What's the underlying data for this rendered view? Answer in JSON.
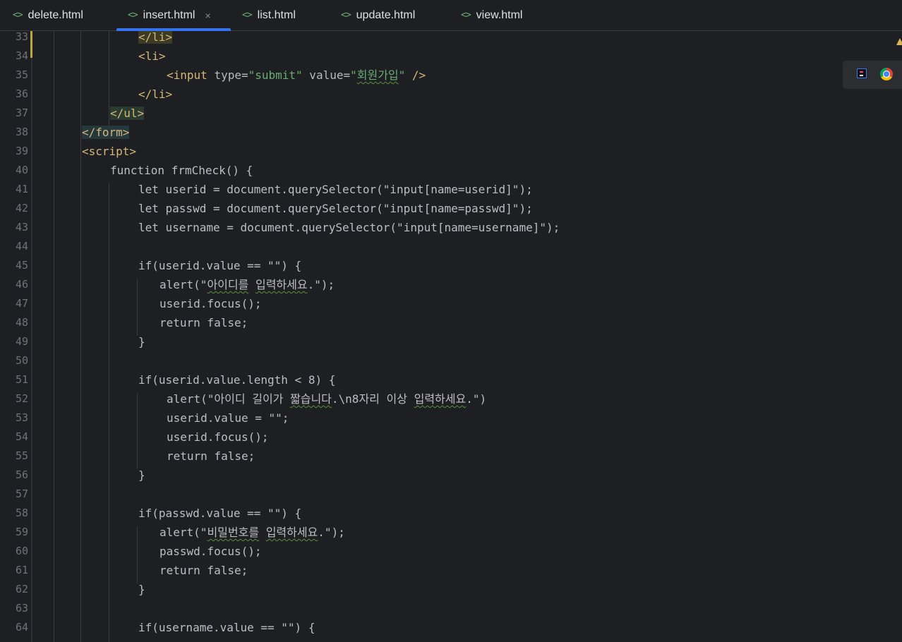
{
  "tabs": [
    {
      "label": "delete.html",
      "icon": "<>"
    },
    {
      "label": "insert.html",
      "icon": "<>",
      "active": true
    },
    {
      "label": "list.html",
      "icon": "<>"
    },
    {
      "label": "update.html",
      "icon": "<>"
    },
    {
      "label": "view.html",
      "icon": "<>"
    }
  ],
  "close_glyph": "×",
  "lines": [
    {
      "n": "33"
    },
    {
      "n": "34"
    },
    {
      "n": "35"
    },
    {
      "n": "36"
    },
    {
      "n": "37"
    },
    {
      "n": "38"
    },
    {
      "n": "39"
    },
    {
      "n": "40"
    },
    {
      "n": "41"
    },
    {
      "n": "42"
    },
    {
      "n": "43"
    },
    {
      "n": "44"
    },
    {
      "n": "45"
    },
    {
      "n": "46"
    },
    {
      "n": "47"
    },
    {
      "n": "48"
    },
    {
      "n": "49"
    },
    {
      "n": "50"
    },
    {
      "n": "51"
    },
    {
      "n": "52"
    },
    {
      "n": "53"
    },
    {
      "n": "54"
    },
    {
      "n": "55"
    },
    {
      "n": "56"
    },
    {
      "n": "57"
    },
    {
      "n": "58"
    },
    {
      "n": "59"
    },
    {
      "n": "60"
    },
    {
      "n": "61"
    },
    {
      "n": "62"
    },
    {
      "n": "63"
    },
    {
      "n": "64"
    }
  ],
  "code": {
    "l33": "</li>",
    "l34": "<li>",
    "l35_open": "<input ",
    "l35_attr1": "type=",
    "l35_val1": "\"submit\"",
    "l35_attr2": " value=",
    "l35_q1": "\"",
    "l35_val2": "회원가입",
    "l35_q2": "\"",
    "l35_close": " />",
    "l36": "</li>",
    "l37": "</ul>",
    "l38": "</form>",
    "l39": "<script>",
    "l40": "function frmCheck() {",
    "l41": "let userid = document.querySelector(\"input[name=userid]\");",
    "l42": "let passwd = document.querySelector(\"input[name=passwd]\");",
    "l43": "let username = document.querySelector(\"input[name=username]\");",
    "l45": "if(userid.value == \"\") {",
    "l46_a": "alert(\"",
    "l46_b": "아이디를",
    "l46_c": " ",
    "l46_d": "입력하세요",
    "l46_e": ".\");",
    "l47": "userid.focus();",
    "l48": "return false;",
    "l49": "}",
    "l51": "if(userid.value.length < 8) {",
    "l52_a": "alert(\"아이디 길이가 ",
    "l52_b": "짧습니다",
    "l52_c": ".\\n8자리 이상 ",
    "l52_d": "입력하세요",
    "l52_e": ".\")",
    "l53": "userid.value = \"\";",
    "l54": "userid.focus();",
    "l55": "return false;",
    "l56": "}",
    "l58": "if(passwd.value == \"\") {",
    "l59_a": "alert(\"",
    "l59_b": "비밀번호를",
    "l59_c": " ",
    "l59_d": "입력하세요",
    "l59_e": ".\");",
    "l60": "passwd.focus();",
    "l61": "return false;",
    "l62": "}",
    "l64": "if(username.value == \"\") {"
  },
  "colors": {
    "background": "#1e1f22",
    "tag": "#d5b778",
    "string": "#6aab73",
    "accent": "#3574f0"
  }
}
